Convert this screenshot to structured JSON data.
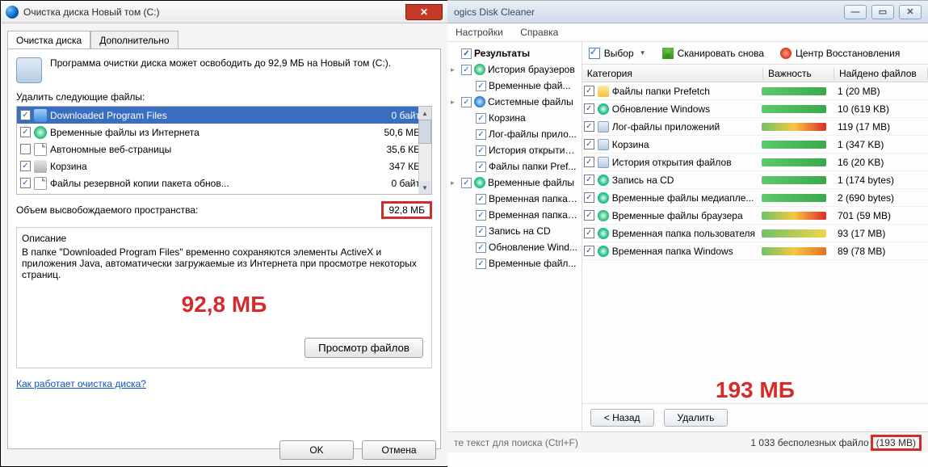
{
  "left": {
    "title": "Очистка диска Новый том (C:)",
    "tabs": {
      "main": "Очистка диска",
      "extra": "Дополнительно"
    },
    "intro": "Программа очистки диска может освободить до 92,9 МБ на Новый том (C:).",
    "delete_label": "Удалить следующие файлы:",
    "files": [
      {
        "checked": true,
        "icon": "fi-blue",
        "name": "Downloaded Program Files",
        "size": "0 байт",
        "selected": true
      },
      {
        "checked": true,
        "icon": "fi-globe",
        "name": "Временные файлы из Интернета",
        "size": "50,6 МБ"
      },
      {
        "checked": false,
        "icon": "fi-page",
        "name": "Автономные веб-страницы",
        "size": "35,6 КБ"
      },
      {
        "checked": true,
        "icon": "fi-bin",
        "name": "Корзина",
        "size": "347 КБ"
      },
      {
        "checked": true,
        "icon": "fi-page",
        "name": "Файлы резервной копии пакета обнов...",
        "size": "0 байт"
      }
    ],
    "free_label": "Объем высвобождаемого пространства:",
    "free_value": "92,8 МБ",
    "desc_title": "Описание",
    "desc_text": "В папке \"Downloaded Program Files\" временно сохраняются элементы ActiveX и приложения Java, автоматически загружаемые из Интернета при просмотре некоторых страниц.",
    "big_size": "92,8 МБ",
    "view_files": "Просмотр файлов",
    "help_link": "Как работает очистка диска?",
    "ok": "OK",
    "cancel": "Отмена"
  },
  "right": {
    "title": "ogics Disk Cleaner",
    "menu": {
      "settings": "Настройки",
      "help": "Справка"
    },
    "toolbar": {
      "select": "Выбор",
      "rescan": "Сканировать снова",
      "recovery": "Центр Восстановления"
    },
    "tree": [
      {
        "indent": 0,
        "twisty": "",
        "checked": true,
        "icon": "",
        "label": "Результаты",
        "bold": true
      },
      {
        "indent": 0,
        "twisty": "▸",
        "checked": true,
        "icon": "ci-globe",
        "label": "История браузеров"
      },
      {
        "indent": 1,
        "twisty": "",
        "checked": true,
        "icon": "",
        "label": "Временные фай..."
      },
      {
        "indent": 0,
        "twisty": "▸",
        "checked": true,
        "icon": "ci-sys",
        "label": "Системные файлы"
      },
      {
        "indent": 1,
        "twisty": "",
        "checked": true,
        "icon": "",
        "label": "Корзина"
      },
      {
        "indent": 1,
        "twisty": "",
        "checked": true,
        "icon": "",
        "label": "Лог-файлы прило..."
      },
      {
        "indent": 1,
        "twisty": "",
        "checked": true,
        "icon": "",
        "label": "История открытия..."
      },
      {
        "indent": 1,
        "twisty": "",
        "checked": true,
        "icon": "",
        "label": "Файлы папки Pref..."
      },
      {
        "indent": 0,
        "twisty": "▸",
        "checked": true,
        "icon": "ci-cd",
        "label": "Временные файлы"
      },
      {
        "indent": 1,
        "twisty": "",
        "checked": true,
        "icon": "",
        "label": "Временная папка ..."
      },
      {
        "indent": 1,
        "twisty": "",
        "checked": true,
        "icon": "",
        "label": "Временная папка ..."
      },
      {
        "indent": 1,
        "twisty": "",
        "checked": true,
        "icon": "",
        "label": "Запись на CD"
      },
      {
        "indent": 1,
        "twisty": "",
        "checked": true,
        "icon": "",
        "label": "Обновление Wind..."
      },
      {
        "indent": 1,
        "twisty": "",
        "checked": true,
        "icon": "",
        "label": "Временные файл..."
      }
    ],
    "columns": {
      "category": "Категория",
      "importance": "Важность",
      "found": "Найдено файлов"
    },
    "rows": [
      {
        "icon": "ic-folder",
        "name": "Файлы папки Prefetch",
        "imp": "imp-green",
        "count": "1 (20 MB)"
      },
      {
        "icon": "ci-cd",
        "name": "Обновление Windows",
        "imp": "imp-green",
        "count": "10 (619 KB)"
      },
      {
        "icon": "ic-drive",
        "name": "Лог-файлы приложений",
        "imp": "imp-red",
        "count": "119 (17 MB)"
      },
      {
        "icon": "ic-drive",
        "name": "Корзина",
        "imp": "imp-green",
        "count": "1 (347 KB)"
      },
      {
        "icon": "ic-drive",
        "name": "История открытия файлов",
        "imp": "imp-green",
        "count": "16 (20 KB)"
      },
      {
        "icon": "ci-cd",
        "name": "Запись на CD",
        "imp": "imp-green",
        "count": "1 (174 bytes)"
      },
      {
        "icon": "ci-cd",
        "name": "Временные файлы медиапле...",
        "imp": "imp-green",
        "count": "2 (690 bytes)"
      },
      {
        "icon": "ci-globe",
        "name": "Временные файлы браузера",
        "imp": "imp-red",
        "count": "701 (59 MB)"
      },
      {
        "icon": "ci-cd",
        "name": "Временная папка пользователя",
        "imp": "imp-yellow",
        "count": "93 (17 MB)"
      },
      {
        "icon": "ci-cd",
        "name": "Временная папка Windows",
        "imp": "imp-orange",
        "count": "89 (78 MB)"
      }
    ],
    "big_size": "193 МБ",
    "back": "< Назад",
    "delete": "Удалить",
    "search_hint": "те текст для поиска (Ctrl+F)",
    "status_count": "1 033 бесполезных файло",
    "status_size": "(193 MB)"
  }
}
